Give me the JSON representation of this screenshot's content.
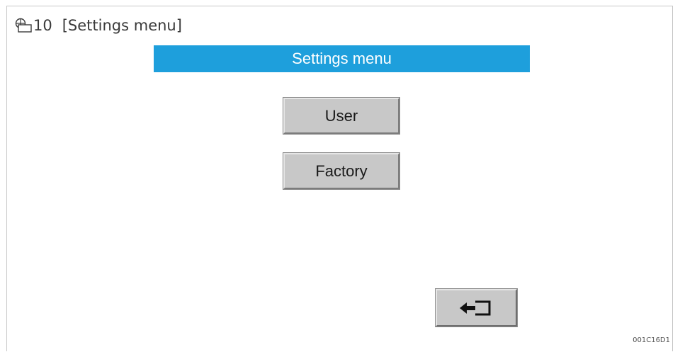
{
  "figure": {
    "number": "10",
    "title": "[Settings menu]",
    "icon": "screen-figure-icon",
    "reference_code": "001C16D1"
  },
  "screen": {
    "header_title": "Settings menu",
    "header_color": "#1e9fdc",
    "buttons": [
      {
        "label": "User"
      },
      {
        "label": "Factory"
      }
    ],
    "back_button": {
      "icon": "back-arrow-icon"
    }
  }
}
